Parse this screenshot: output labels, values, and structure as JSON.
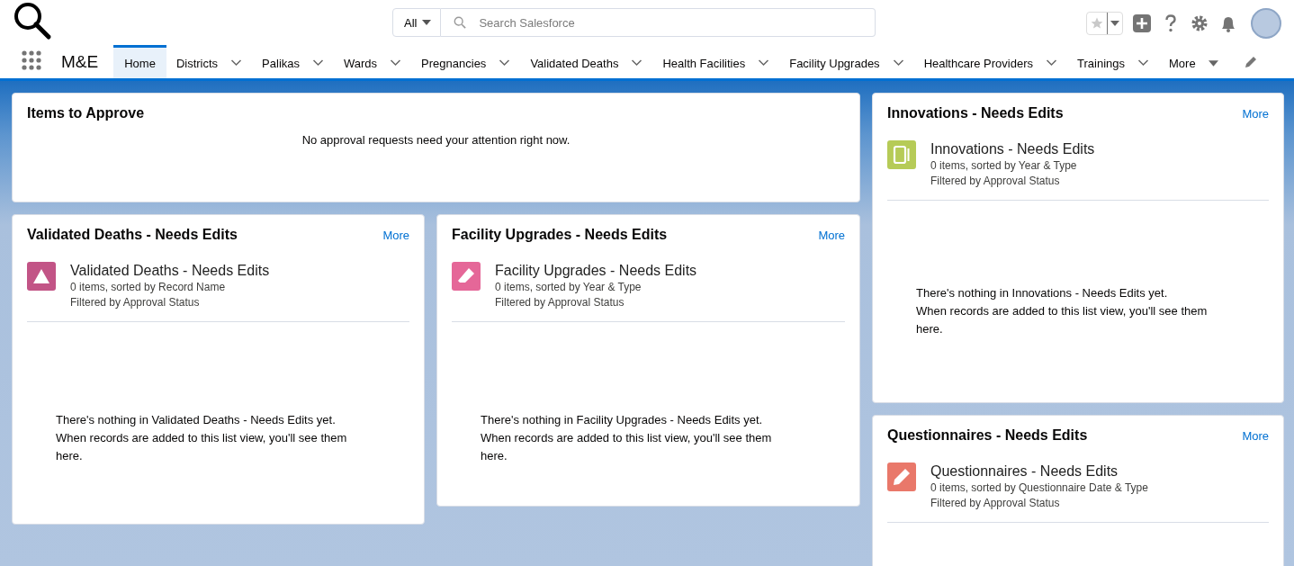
{
  "header": {
    "search_scope": "All",
    "search": {
      "placeholder": "Search Salesforce"
    }
  },
  "nav": {
    "app_name": "M&E",
    "tabs": [
      {
        "label": "Home",
        "selected": true,
        "dropdown": false
      },
      {
        "label": "Districts",
        "selected": false,
        "dropdown": true
      },
      {
        "label": "Palikas",
        "selected": false,
        "dropdown": true
      },
      {
        "label": "Wards",
        "selected": false,
        "dropdown": true
      },
      {
        "label": "Pregnancies",
        "selected": false,
        "dropdown": true
      },
      {
        "label": "Validated Deaths",
        "selected": false,
        "dropdown": true
      },
      {
        "label": "Health Facilities",
        "selected": false,
        "dropdown": true
      },
      {
        "label": "Facility Upgrades",
        "selected": false,
        "dropdown": true
      },
      {
        "label": "Healthcare Providers",
        "selected": false,
        "dropdown": true
      },
      {
        "label": "Trainings",
        "selected": false,
        "dropdown": true
      }
    ],
    "more": "More"
  },
  "approvals": {
    "title": "Items to Approve",
    "message": "No approval requests need your attention right now."
  },
  "left_cards": [
    {
      "title": "Validated Deaths - Needs Edits",
      "more": "More",
      "list": {
        "kind": "triangle",
        "color": "#c25486",
        "name": "Validated Deaths - Needs Edits",
        "sorted": "0 items, sorted by Record Name",
        "filtered": "Filtered by Approval Status"
      },
      "empty": [
        "There's nothing in Validated Deaths - Needs Edits yet.",
        "When records are added to this list view, you'll see them here."
      ]
    },
    {
      "title": "Facility Upgrades - Needs Edits",
      "more": "More",
      "list": {
        "kind": "eraser",
        "color": "#e56798",
        "name": "Facility Upgrades - Needs Edits",
        "sorted": "0 items, sorted by Year & Type",
        "filtered": "Filtered by Approval Status"
      },
      "empty": [
        "There's nothing in Facility Upgrades - Needs Edits yet.",
        "When records are added to this list view, you'll see them here."
      ]
    }
  ],
  "right_cards": [
    {
      "title": "Innovations - Needs Edits",
      "more": "More",
      "list": {
        "kind": "tablet",
        "color": "#b6cb57",
        "name": "Innovations - Needs Edits",
        "sorted": "0 items, sorted by Year & Type",
        "filtered": "Filtered by Approval Status"
      },
      "empty": [
        "There's nothing in Innovations - Needs Edits yet.",
        "When records are added to this list view, you'll see them here."
      ]
    },
    {
      "title": "Questionnaires - Needs Edits",
      "more": "More",
      "list": {
        "kind": "pencil",
        "color": "#e9786a",
        "name": "Questionnaires - Needs Edits",
        "sorted": "0 items, sorted by Questionnaire Date & Type",
        "filtered": "Filtered by Approval Status"
      }
    }
  ]
}
